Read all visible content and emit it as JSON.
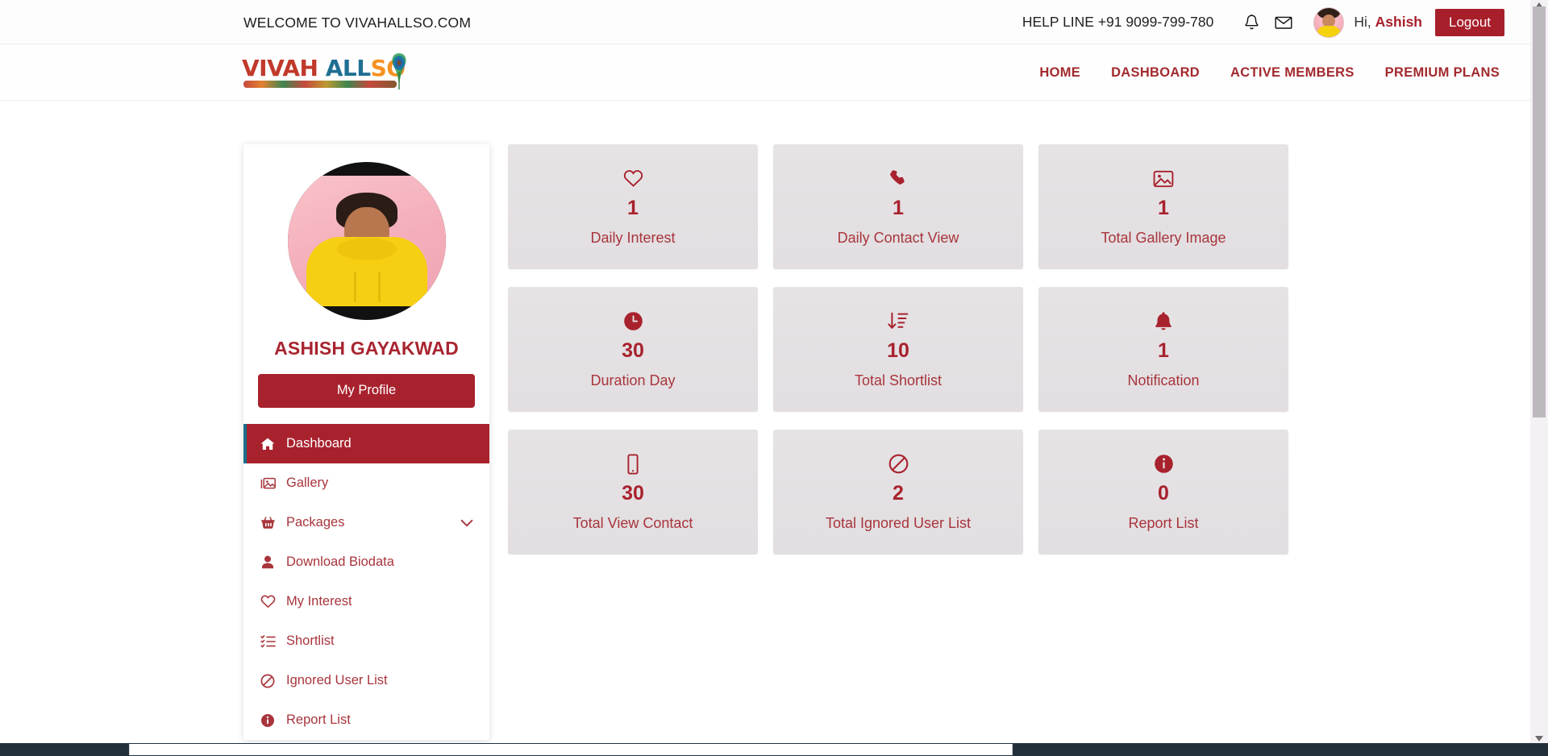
{
  "topbar": {
    "welcome": "WELCOME TO VIVAHALLSO.COM",
    "helpline": "HELP LINE +91 9099-799-780",
    "bell_icon": "bell-icon",
    "mail_icon": "envelope-icon",
    "greeting_prefix": "Hi,",
    "user_name": "Ashish",
    "logout_label": "Logout"
  },
  "brand": {
    "part1": "VIVAH",
    "part2": " ALL",
    "part3": "SO",
    "color1": "#c0392b",
    "color2": "#1f6f93",
    "color3": "#f59121"
  },
  "nav": {
    "items": [
      {
        "label": "HOME"
      },
      {
        "label": "DASHBOARD"
      },
      {
        "label": "ACTIVE MEMBERS"
      },
      {
        "label": "PREMIUM PLANS"
      }
    ]
  },
  "profile": {
    "name": "ASHISH GAYAKWAD",
    "my_profile_label": "My Profile"
  },
  "sidebar": {
    "items": [
      {
        "label": "Dashboard",
        "icon": "home-icon",
        "active": true,
        "chevron": false
      },
      {
        "label": "Gallery",
        "icon": "image-icon",
        "active": false,
        "chevron": false
      },
      {
        "label": "Packages",
        "icon": "basket-icon",
        "active": false,
        "chevron": true
      },
      {
        "label": "Download Biodata",
        "icon": "user-icon",
        "active": false,
        "chevron": false
      },
      {
        "label": "My Interest",
        "icon": "heart-icon",
        "active": false,
        "chevron": false
      },
      {
        "label": "Shortlist",
        "icon": "list-check-icon",
        "active": false,
        "chevron": false
      },
      {
        "label": "Ignored User List",
        "icon": "ban-icon",
        "active": false,
        "chevron": false
      },
      {
        "label": "Report List",
        "icon": "info-circle-icon",
        "active": false,
        "chevron": false
      }
    ]
  },
  "stats": {
    "cards": [
      {
        "icon": "heart-icon",
        "value": "1",
        "label": "Daily Interest"
      },
      {
        "icon": "phone-icon",
        "value": "1",
        "label": "Daily Contact View"
      },
      {
        "icon": "image-icon",
        "value": "1",
        "label": "Total Gallery Image"
      },
      {
        "icon": "clock-icon",
        "value": "30",
        "label": "Duration Day"
      },
      {
        "icon": "sort-amount-icon",
        "value": "10",
        "label": "Total Shortlist"
      },
      {
        "icon": "bell-icon",
        "value": "1",
        "label": "Notification"
      },
      {
        "icon": "mobile-icon",
        "value": "30",
        "label": "Total View Contact"
      },
      {
        "icon": "ban-icon",
        "value": "2",
        "label": "Total Ignored User List"
      },
      {
        "icon": "info-circle-icon",
        "value": "0",
        "label": "Report List"
      }
    ]
  },
  "theme": {
    "primary": "#a8222d",
    "primary_text": "#a8353c",
    "accent_blue": "#1b6e89",
    "card_bg": "#e4e1e3"
  }
}
